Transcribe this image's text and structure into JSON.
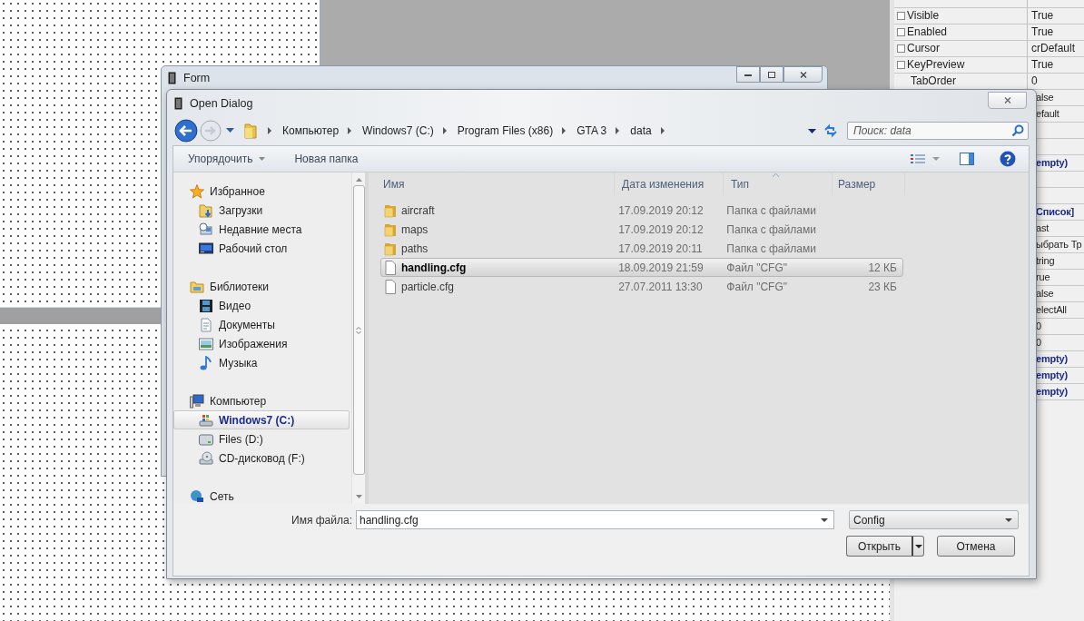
{
  "designer": {
    "form_window": {
      "title": "Form"
    }
  },
  "inspector": {
    "rows": [
      {
        "name": "Visible",
        "value": "True",
        "kind": "checkbox",
        "checked": false
      },
      {
        "name": "Enabled",
        "value": "True",
        "kind": "checkbox",
        "checked": false
      },
      {
        "name": "Cursor",
        "value": "crDefault",
        "kind": "checkbox",
        "checked": false
      },
      {
        "name": "KeyPreview",
        "value": "True",
        "kind": "checkbox",
        "checked": false
      },
      {
        "name": "TabOrder",
        "value": "0",
        "kind": "plain"
      },
      {
        "value": "alse",
        "kind": "covered"
      },
      {
        "value": "efault",
        "kind": "covered"
      },
      {
        "kind": "covered"
      },
      {
        "kind": "covered"
      },
      {
        "value": "empty)",
        "kind": "covered",
        "bold": true
      },
      {
        "kind": "covered"
      },
      {
        "kind": "covered"
      },
      {
        "value": "Список]",
        "kind": "covered",
        "bold": true
      },
      {
        "value": "ast",
        "kind": "covered"
      },
      {
        "value": "ыбрать Тр",
        "kind": "covered"
      },
      {
        "value": "tring",
        "kind": "covered"
      },
      {
        "value": "rue",
        "kind": "covered"
      },
      {
        "value": "alse",
        "kind": "covered"
      },
      {
        "value": "electAll",
        "kind": "covered"
      },
      {
        "value": "0",
        "kind": "covered"
      },
      {
        "value": "0",
        "kind": "covered"
      },
      {
        "value": "empty)",
        "kind": "covered",
        "bold": true
      },
      {
        "value": "empty)",
        "kind": "covered",
        "bold": true
      },
      {
        "value": "empty)",
        "kind": "covered",
        "bold": true
      }
    ]
  },
  "dialog": {
    "title": "Open Dialog",
    "breadcrumb": [
      "Компьютер",
      "Windows7 (C:)",
      "Program Files (x86)",
      "GTA 3",
      "data"
    ],
    "search": {
      "placeholder": "Поиск: data"
    },
    "toolbar": {
      "organize": "Упорядочить",
      "new_folder": "Новая папка"
    },
    "nav": [
      {
        "label": "Избранное",
        "selected": false,
        "children": [
          {
            "label": "Загрузки",
            "selected": false
          },
          {
            "label": "Недавние места",
            "selected": false
          },
          {
            "label": "Рабочий стол",
            "selected": false
          }
        ]
      },
      {
        "label": "Библиотеки",
        "selected": false,
        "children": [
          {
            "label": "Видео",
            "selected": false
          },
          {
            "label": "Документы",
            "selected": false
          },
          {
            "label": "Изображения",
            "selected": false
          },
          {
            "label": "Музыка",
            "selected": false
          }
        ]
      },
      {
        "label": "Компьютер",
        "selected": false,
        "children": [
          {
            "label": "Windows7 (C:)",
            "selected": true
          },
          {
            "label": "Files (D:)",
            "selected": false
          },
          {
            "label": "CD-дисковод (F:)",
            "selected": false
          }
        ]
      },
      {
        "label": "Сеть",
        "selected": false
      }
    ],
    "columns": [
      {
        "label": "Имя",
        "sorted": false
      },
      {
        "label": "Дата изменения",
        "sorted": false
      },
      {
        "label": "Тип",
        "sorted": true
      },
      {
        "label": "Размер",
        "sorted": false
      }
    ],
    "files": [
      {
        "kind": "folder",
        "name": "aircraft",
        "date": "17.09.2019 20:12",
        "type": "Папка с файлами",
        "selected": false
      },
      {
        "kind": "folder",
        "name": "maps",
        "date": "17.09.2019 20:12",
        "type": "Папка с файлами",
        "selected": false
      },
      {
        "kind": "folder",
        "name": "paths",
        "date": "17.09.2019 20:11",
        "type": "Папка с файлами",
        "selected": false
      },
      {
        "kind": "file",
        "name": "handling.cfg",
        "date": "18.09.2019 21:59",
        "type": "Файл \"CFG\"",
        "size": "12 КБ",
        "selected": true
      },
      {
        "kind": "file",
        "name": "particle.cfg",
        "date": "27.07.2011 13:30",
        "type": "Файл \"CFG\"",
        "size": "23 КБ",
        "selected": false
      }
    ],
    "filename": {
      "label": "Имя файла:",
      "value": "handling.cfg"
    },
    "filter": "Config",
    "buttons": {
      "open": "Открыть",
      "cancel": "Отмена"
    }
  }
}
